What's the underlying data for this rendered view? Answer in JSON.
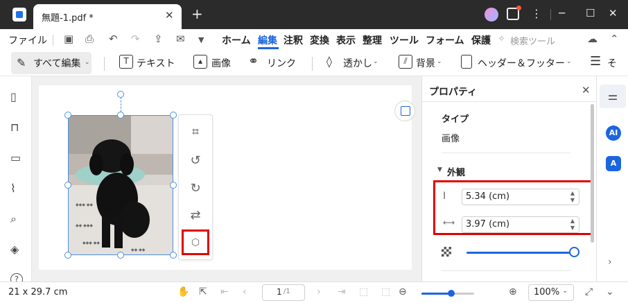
{
  "titlebar": {
    "tab_title": "無題-1.pdf *",
    "tab_close": "✕",
    "new_tab": "+",
    "more": "⋮",
    "minimize": "─",
    "maximize": "☐",
    "close": "✕"
  },
  "menu": {
    "file": "ファイル",
    "tabs": [
      {
        "label": "ホーム",
        "active": false
      },
      {
        "label": "編集",
        "active": true
      },
      {
        "label": "注釈",
        "active": false
      },
      {
        "label": "変換",
        "active": false
      },
      {
        "label": "表示",
        "active": false
      },
      {
        "label": "整理",
        "active": false
      },
      {
        "label": "ツール",
        "active": false
      },
      {
        "label": "フォーム",
        "active": false
      },
      {
        "label": "保護",
        "active": false
      }
    ],
    "search_tools": "検索ツール"
  },
  "toolbar": {
    "all_edit": "すべて編集",
    "text": "テキスト",
    "image": "画像",
    "link": "リンク",
    "watermark": "透かし",
    "background": "背景",
    "header_footer": "ヘッダー＆フッター",
    "more": "そ"
  },
  "properties": {
    "title": "プロパティ",
    "type_label": "タイプ",
    "type_value": "画像",
    "appearance_label": "外観",
    "height_value": "5.34 (cm)",
    "width_value": "3.97 (cm)",
    "opacity": 1.0
  },
  "right_rail": {
    "ai": "AI",
    "translate": "A"
  },
  "status": {
    "page_size": "21 x 29.7 cm",
    "page_current": "1",
    "page_total": "/1",
    "zoom": "100%",
    "zoom_fraction": 0.55
  },
  "colors": {
    "accent": "#1c65e0",
    "highlight": "#e00000",
    "titlebar": "#2b2b2b"
  }
}
